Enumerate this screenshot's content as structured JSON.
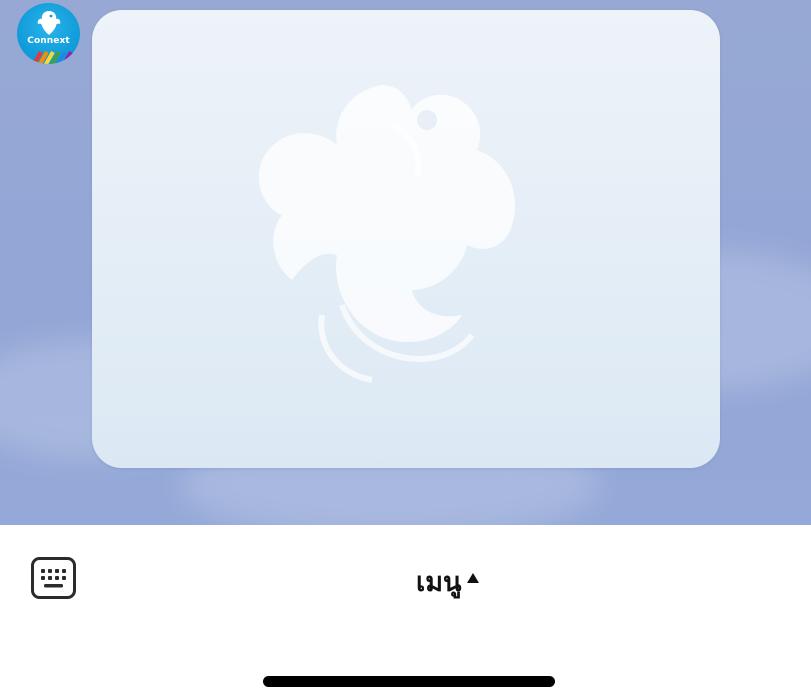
{
  "bot": {
    "avatar_label": "Connext",
    "avatar_icon": "krungthai-bird-logo-icon"
  },
  "message": {
    "watermark_icon": "garuda-bird-watermark-icon"
  },
  "bottom_bar": {
    "keyboard_icon": "keyboard-icon",
    "menu_label": "เมนู",
    "menu_caret_icon": "caret-up-icon"
  },
  "colors": {
    "chat_background": "#93a6d6",
    "card_background": "#e3edf6",
    "avatar_blue": "#0f9ad8",
    "text_dark": "#111111"
  }
}
